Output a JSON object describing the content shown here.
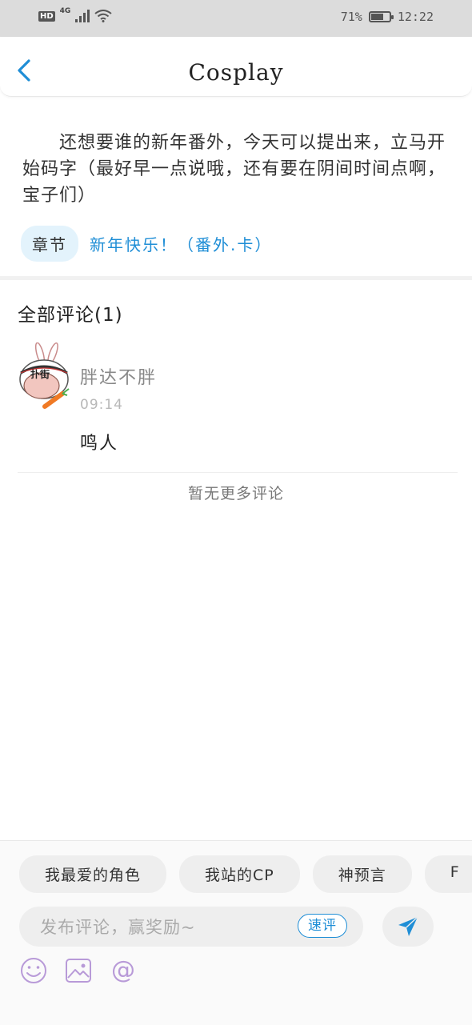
{
  "status_bar": {
    "hd": "HD",
    "network": "4G",
    "battery_percent": "71%",
    "battery_level": 0.71,
    "time": "12:22"
  },
  "header": {
    "back_icon": "chevron-left-icon",
    "title": "Cosplay"
  },
  "post": {
    "intro": "还想要谁的新年番外，今天可以提出来，立马开始码字（最好早一点说哦，还有要在阴间时间点啊，宝子们）",
    "chapter_tag": "章节",
    "chapter_link": "新年快乐！（番外.卡）"
  },
  "comments": {
    "title": "全部评论(1)",
    "items": [
      {
        "author": "胖达不胖",
        "time": "09:14",
        "text": "鸣人",
        "avatar_text": "扑街"
      }
    ],
    "no_more": "暂无更多评论"
  },
  "composer": {
    "chips": [
      "我最爱的角色",
      "我站的CP",
      "神预言",
      "F"
    ],
    "placeholder": "发布评论，赢奖励~",
    "quick_review": "速评",
    "send_icon": "send-icon",
    "tools": [
      "emoji-icon",
      "image-icon",
      "at-icon"
    ]
  },
  "colors": {
    "accent": "#1f8ed6",
    "chip_bg": "#eeeeee",
    "tag_bg": "#e3f3fc",
    "tool_icon": "#b89ad8"
  }
}
